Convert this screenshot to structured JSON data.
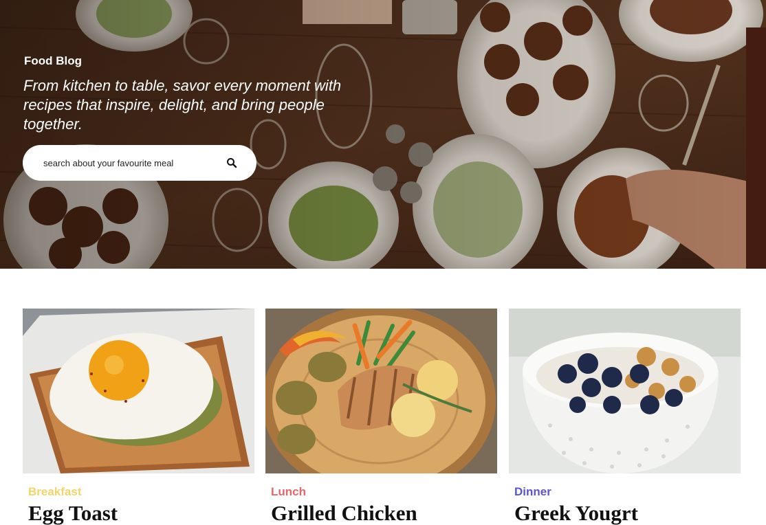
{
  "hero": {
    "brand": "Food Blog",
    "tagline": "From kitchen to table, savor every moment with recipes that inspire, delight, and bring people together.",
    "search": {
      "placeholder": "search about your favourite meal",
      "icon": "search-icon"
    }
  },
  "cards": [
    {
      "category": "Breakfast",
      "category_color": "#f3d46b",
      "title": "Egg Toast"
    },
    {
      "category": "Lunch",
      "category_color": "#e8666a",
      "title": "Grilled Chicken"
    },
    {
      "category": "Dinner",
      "category_color": "#5a55d6",
      "title": "Greek Yougrt"
    }
  ]
}
